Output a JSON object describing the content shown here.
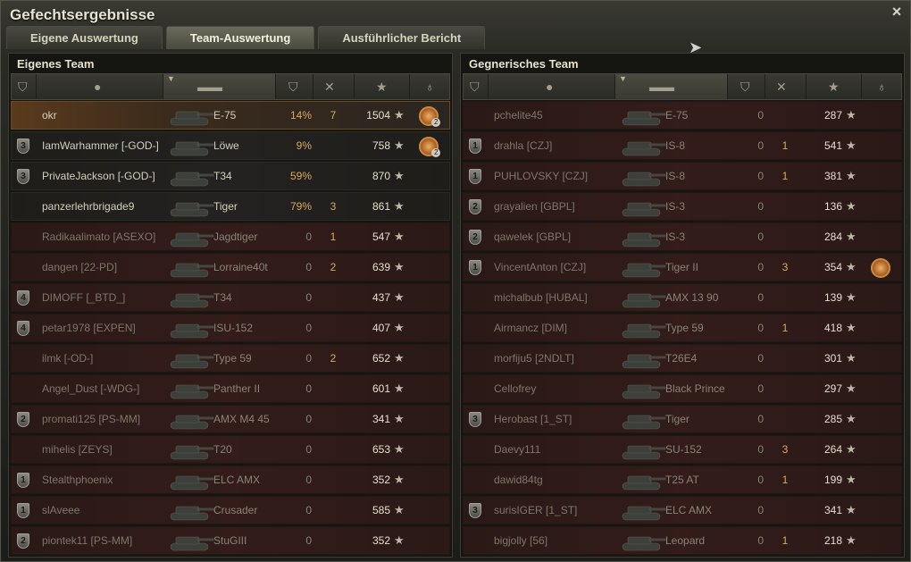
{
  "window": {
    "title": "Gefechtsergebnisse",
    "close_icon": "×"
  },
  "tabs": [
    {
      "label": "Eigene Auswertung",
      "active": false
    },
    {
      "label": "Team-Auswertung",
      "active": true
    },
    {
      "label": "Ausführlicher Bericht",
      "active": false
    }
  ],
  "header_icons": [
    "platoon-icon",
    "player-icon",
    "tank-icon",
    "damage-icon",
    "kills-icon",
    "xp-star-icon",
    "medal-icon"
  ],
  "own_team": {
    "title": "Eigenes Team",
    "rows": [
      {
        "badge": "",
        "name": "okr",
        "tank": "E-75",
        "dmg": "14%",
        "kills": "7",
        "xp": "1504",
        "medal": "2",
        "state": "player"
      },
      {
        "badge": "3",
        "name": "IamWarhammer [-GOD-]",
        "tank": "Löwe",
        "dmg": "9%",
        "kills": "",
        "xp": "758",
        "medal": "2",
        "state": "ally-alive"
      },
      {
        "badge": "3",
        "name": "PrivateJackson [-GOD-]",
        "tank": "T34",
        "dmg": "59%",
        "kills": "",
        "xp": "870",
        "medal": "",
        "state": "ally-alive"
      },
      {
        "badge": "",
        "name": "panzerlehrbrigade9",
        "tank": "Tiger",
        "dmg": "79%",
        "kills": "3",
        "xp": "861",
        "medal": "",
        "state": "ally-alive"
      },
      {
        "badge": "",
        "name": "Radikaalimato [ASEXO]",
        "tank": "Jagdtiger",
        "dmg": "0",
        "kills": "1",
        "xp": "547",
        "medal": "",
        "state": "dead"
      },
      {
        "badge": "",
        "name": "dangen [22-PD]",
        "tank": "Lorraine40t",
        "dmg": "0",
        "kills": "2",
        "xp": "639",
        "medal": "",
        "state": "dead"
      },
      {
        "badge": "4",
        "name": "DIMOFF [_BTD_]",
        "tank": "T34",
        "dmg": "0",
        "kills": "",
        "xp": "437",
        "medal": "",
        "state": "dead"
      },
      {
        "badge": "4",
        "name": "petar1978 [EXPEN]",
        "tank": "ISU-152",
        "dmg": "0",
        "kills": "",
        "xp": "407",
        "medal": "",
        "state": "dead"
      },
      {
        "badge": "",
        "name": "ilmk [-OD-]",
        "tank": "Type 59",
        "dmg": "0",
        "kills": "2",
        "xp": "652",
        "medal": "",
        "state": "dead"
      },
      {
        "badge": "",
        "name": "Angel_Dust [-WDG-]",
        "tank": "Panther II",
        "dmg": "0",
        "kills": "",
        "xp": "601",
        "medal": "",
        "state": "dead"
      },
      {
        "badge": "2",
        "name": "promati125 [PS-MM]",
        "tank": "AMX M4 45",
        "dmg": "0",
        "kills": "",
        "xp": "341",
        "medal": "",
        "state": "dead"
      },
      {
        "badge": "",
        "name": "mihelis [ZEYS]",
        "tank": "T20",
        "dmg": "0",
        "kills": "",
        "xp": "653",
        "medal": "",
        "state": "dead"
      },
      {
        "badge": "1",
        "name": "Stealthphoenix",
        "tank": "ELC AMX",
        "dmg": "0",
        "kills": "",
        "xp": "352",
        "medal": "",
        "state": "dead"
      },
      {
        "badge": "1",
        "name": "slAveee",
        "tank": "Crusader",
        "dmg": "0",
        "kills": "",
        "xp": "585",
        "medal": "",
        "state": "dead"
      },
      {
        "badge": "2",
        "name": "piontek11 [PS-MM]",
        "tank": "StuGIII",
        "dmg": "0",
        "kills": "",
        "xp": "352",
        "medal": "",
        "state": "dead"
      }
    ]
  },
  "enemy_team": {
    "title": "Gegnerisches Team",
    "rows": [
      {
        "badge": "",
        "name": "pchelite45",
        "tank": "E-75",
        "dmg": "0",
        "kills": "",
        "xp": "287",
        "medal": ""
      },
      {
        "badge": "1",
        "name": "drahla [CZJ]",
        "tank": "IS-8",
        "dmg": "0",
        "kills": "1",
        "xp": "541",
        "medal": ""
      },
      {
        "badge": "1",
        "name": "PUHLOVSKY [CZJ]",
        "tank": "IS-8",
        "dmg": "0",
        "kills": "1",
        "xp": "381",
        "medal": ""
      },
      {
        "badge": "2",
        "name": "grayalien [GBPL]",
        "tank": "IS-3",
        "dmg": "0",
        "kills": "",
        "xp": "136",
        "medal": ""
      },
      {
        "badge": "2",
        "name": "qawelek [GBPL]",
        "tank": "IS-3",
        "dmg": "0",
        "kills": "",
        "xp": "284",
        "medal": ""
      },
      {
        "badge": "1",
        "name": "VincentAnton [CZJ]",
        "tank": "Tiger II",
        "dmg": "0",
        "kills": "3",
        "xp": "354",
        "medal": "1"
      },
      {
        "badge": "",
        "name": "michalbub [HUBAL]",
        "tank": "AMX 13 90",
        "dmg": "0",
        "kills": "",
        "xp": "139",
        "medal": ""
      },
      {
        "badge": "",
        "name": "Airmancz [DIM]",
        "tank": "Type 59",
        "dmg": "0",
        "kills": "1",
        "xp": "418",
        "medal": ""
      },
      {
        "badge": "",
        "name": "morfiju5 [2NDLT]",
        "tank": "T26E4",
        "dmg": "0",
        "kills": "",
        "xp": "301",
        "medal": ""
      },
      {
        "badge": "",
        "name": "Cellofrey",
        "tank": "Black Prince",
        "dmg": "0",
        "kills": "",
        "xp": "297",
        "medal": ""
      },
      {
        "badge": "3",
        "name": "Herobast [1_ST]",
        "tank": "Tiger",
        "dmg": "0",
        "kills": "",
        "xp": "285",
        "medal": ""
      },
      {
        "badge": "",
        "name": "Daevy111",
        "tank": "SU-152",
        "dmg": "0",
        "kills": "3",
        "xp": "264",
        "medal": ""
      },
      {
        "badge": "",
        "name": "dawid84tg",
        "tank": "T25 AT",
        "dmg": "0",
        "kills": "1",
        "xp": "199",
        "medal": ""
      },
      {
        "badge": "3",
        "name": "surisIGER [1_ST]",
        "tank": "ELC AMX",
        "dmg": "0",
        "kills": "",
        "xp": "341",
        "medal": ""
      },
      {
        "badge": "",
        "name": "bigjolly [56]",
        "tank": "Leopard",
        "dmg": "0",
        "kills": "1",
        "xp": "218",
        "medal": ""
      }
    ]
  },
  "colors": {
    "accent": "#d7a961",
    "dead_row": "#331c1a",
    "alive_row": "#232220",
    "player_row": "#5a3a1c"
  }
}
